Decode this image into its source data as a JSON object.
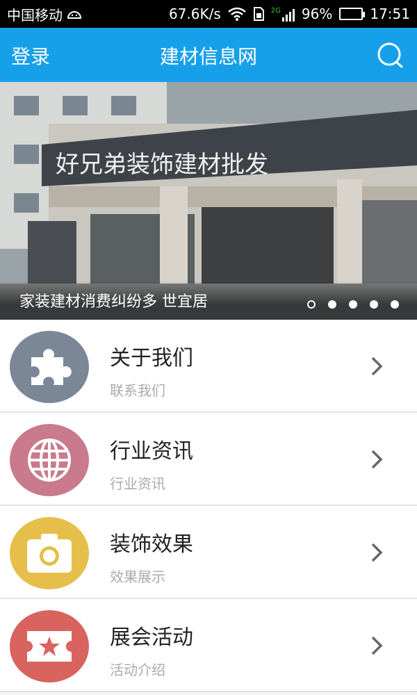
{
  "status_bar": {
    "carrier": "中国移动",
    "net_speed": "67.6K/s",
    "network_type": "2G",
    "battery": "96%",
    "battery_level": 0.96,
    "time": "17:51"
  },
  "app_bar": {
    "login_label": "登录",
    "title": "建材信息网",
    "search_icon": "search-icon"
  },
  "banner": {
    "caption": "家装建材消费纠纷多 世宜居",
    "sign_text": "好兄弟装饰建材批发",
    "dots": [
      "hollow",
      "filled",
      "filled",
      "filled",
      "filled"
    ]
  },
  "menu": [
    {
      "title": "关于我们",
      "subtitle": "联系我们",
      "icon": "puzzle-icon",
      "color": "#7b8797"
    },
    {
      "title": "行业资讯",
      "subtitle": "行业资讯",
      "icon": "globe-icon",
      "color": "#c97a8d"
    },
    {
      "title": "装饰效果",
      "subtitle": "效果展示",
      "icon": "camera-icon",
      "color": "#e5bf4a"
    },
    {
      "title": "展会活动",
      "subtitle": "活动介绍",
      "icon": "ticket-icon",
      "color": "#d9635e"
    }
  ]
}
